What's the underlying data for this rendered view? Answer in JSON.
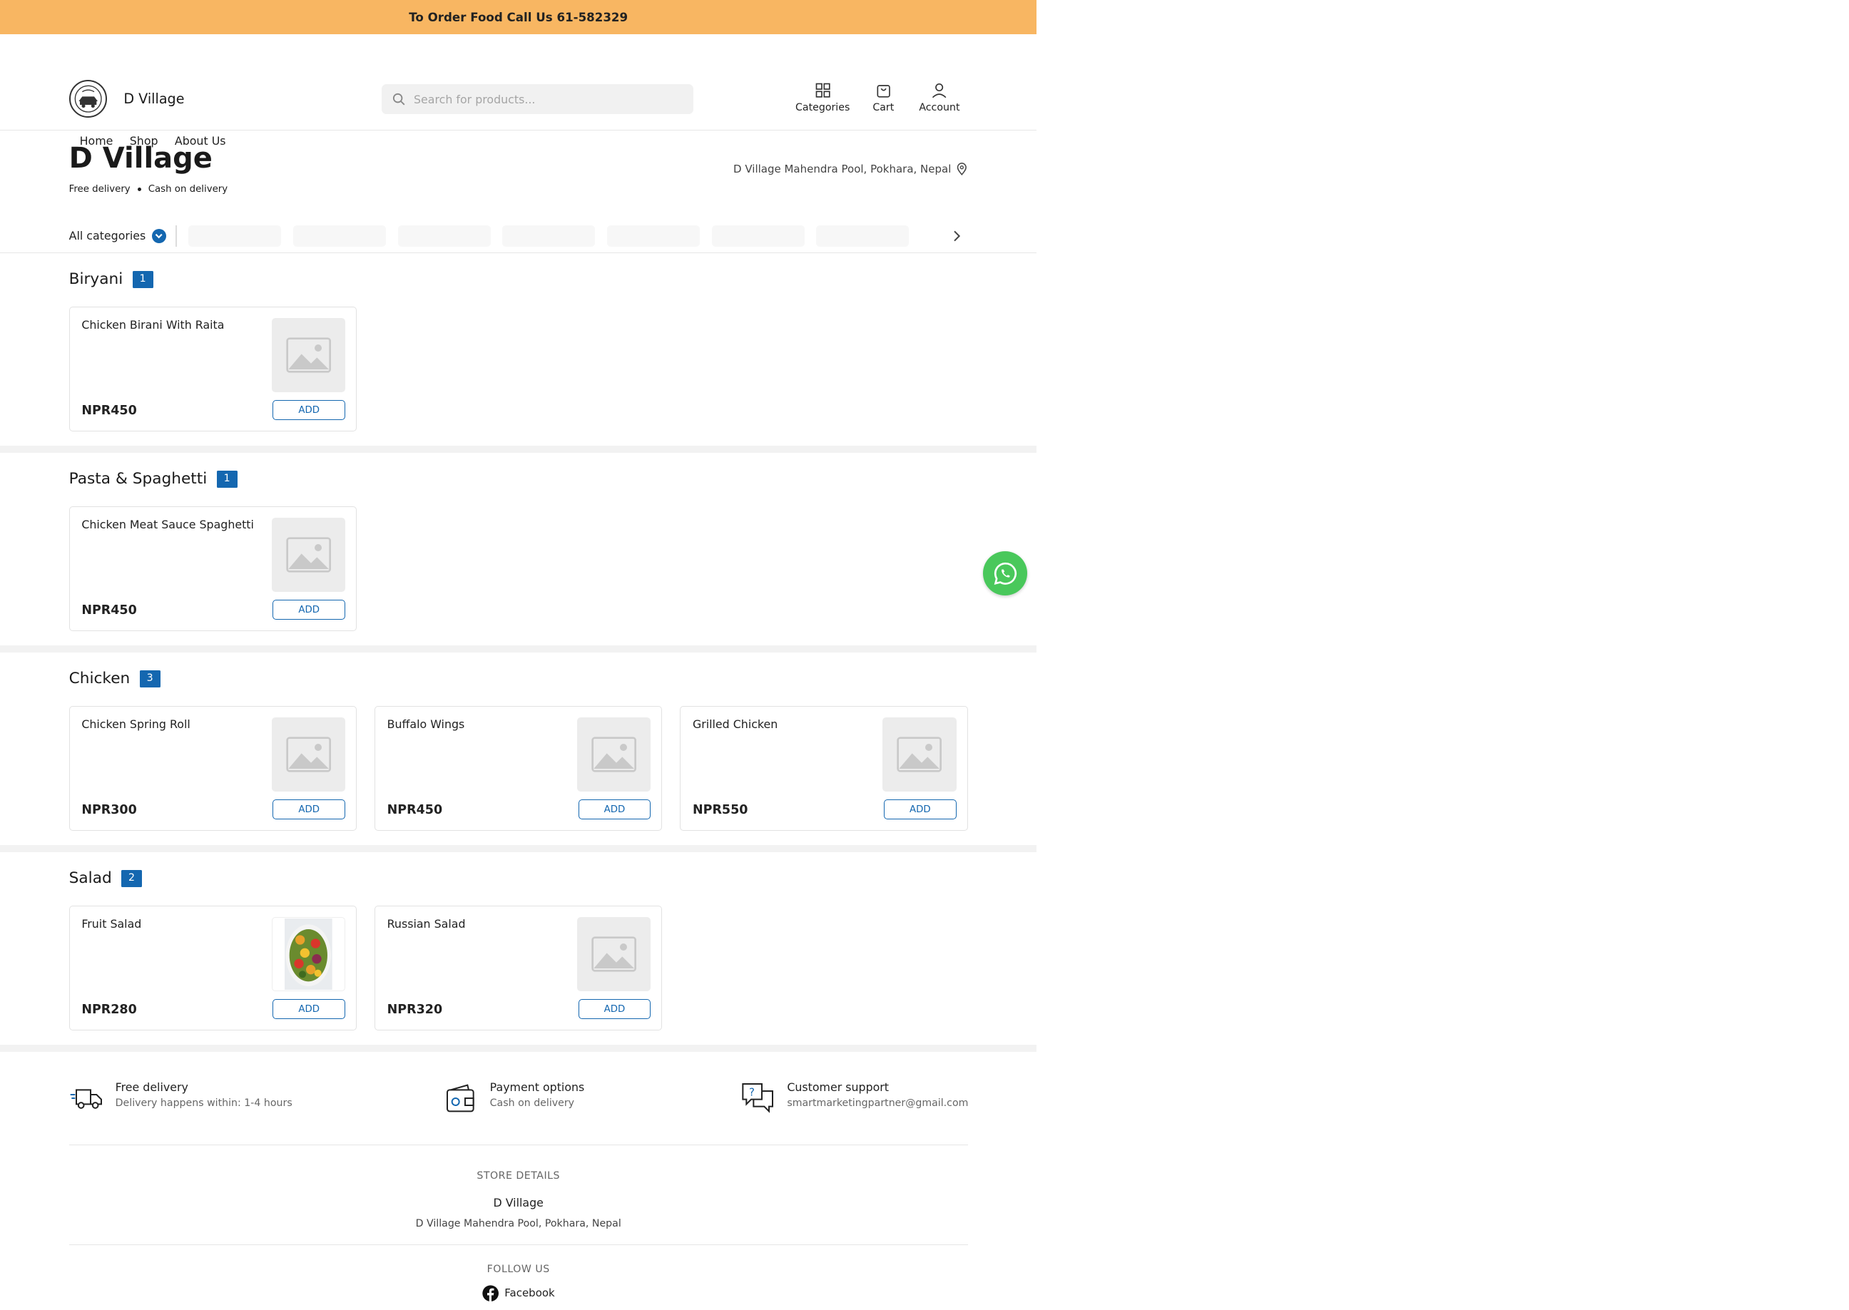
{
  "top_banner": "To Order Food Call Us 61-582329",
  "header": {
    "brand": "D Village",
    "search_placeholder": "Search for products...",
    "icons": [
      {
        "name": "categories",
        "label": "Categories"
      },
      {
        "name": "cart",
        "label": "Cart"
      },
      {
        "name": "account",
        "label": "Account"
      }
    ]
  },
  "nav": [
    "Home",
    "Shop",
    "About Us"
  ],
  "store": {
    "name": "D Village",
    "badge_1": "Free delivery",
    "badge_2": "Cash on delivery",
    "location": "D Village Mahendra Pool, Pokhara, Nepal"
  },
  "category_bar": {
    "label": "All categories"
  },
  "sections": [
    {
      "title": "Biryani",
      "count": "1",
      "items": [
        {
          "name": "Chicken Birani With Raita",
          "price": "NPR450",
          "button": "ADD",
          "image": "placeholder"
        }
      ]
    },
    {
      "title": "Pasta & Spaghetti",
      "count": "1",
      "items": [
        {
          "name": "Chicken Meat Sauce Spaghetti",
          "price": "NPR450",
          "button": "ADD",
          "image": "placeholder"
        }
      ]
    },
    {
      "title": "Chicken",
      "count": "3",
      "items": [
        {
          "name": "Chicken Spring Roll",
          "price": "NPR300",
          "button": "ADD",
          "image": "placeholder"
        },
        {
          "name": "Buffalo Wings",
          "price": "NPR450",
          "button": "ADD",
          "image": "placeholder"
        },
        {
          "name": "Grilled Chicken",
          "price": "NPR550",
          "button": "ADD",
          "image": "placeholder"
        }
      ]
    },
    {
      "title": "Salad",
      "count": "2",
      "items": [
        {
          "name": "Fruit Salad",
          "price": "NPR280",
          "button": "ADD",
          "image": "photo"
        },
        {
          "name": "Russian Salad",
          "price": "NPR320",
          "button": "ADD",
          "image": "placeholder"
        }
      ]
    }
  ],
  "features": [
    {
      "icon": "delivery-truck-icon",
      "title": "Free delivery",
      "subtitle": "Delivery happens within: 1-4 hours"
    },
    {
      "icon": "wallet-icon",
      "title": "Payment options",
      "subtitle": "Cash on delivery"
    },
    {
      "icon": "support-chat-icon",
      "title": "Customer support",
      "subtitle": "smartmarketingpartner@gmail.com"
    }
  ],
  "store_details": {
    "label": "STORE DETAILS",
    "name": "D Village",
    "address": "D Village Mahendra Pool, Pokhara, Nepal"
  },
  "follow": {
    "label": "FOLLOW US",
    "facebook": "Facebook"
  },
  "colors": {
    "banner": "#f8b662",
    "accent": "#1467b0",
    "whatsapp": "#49c85b"
  }
}
